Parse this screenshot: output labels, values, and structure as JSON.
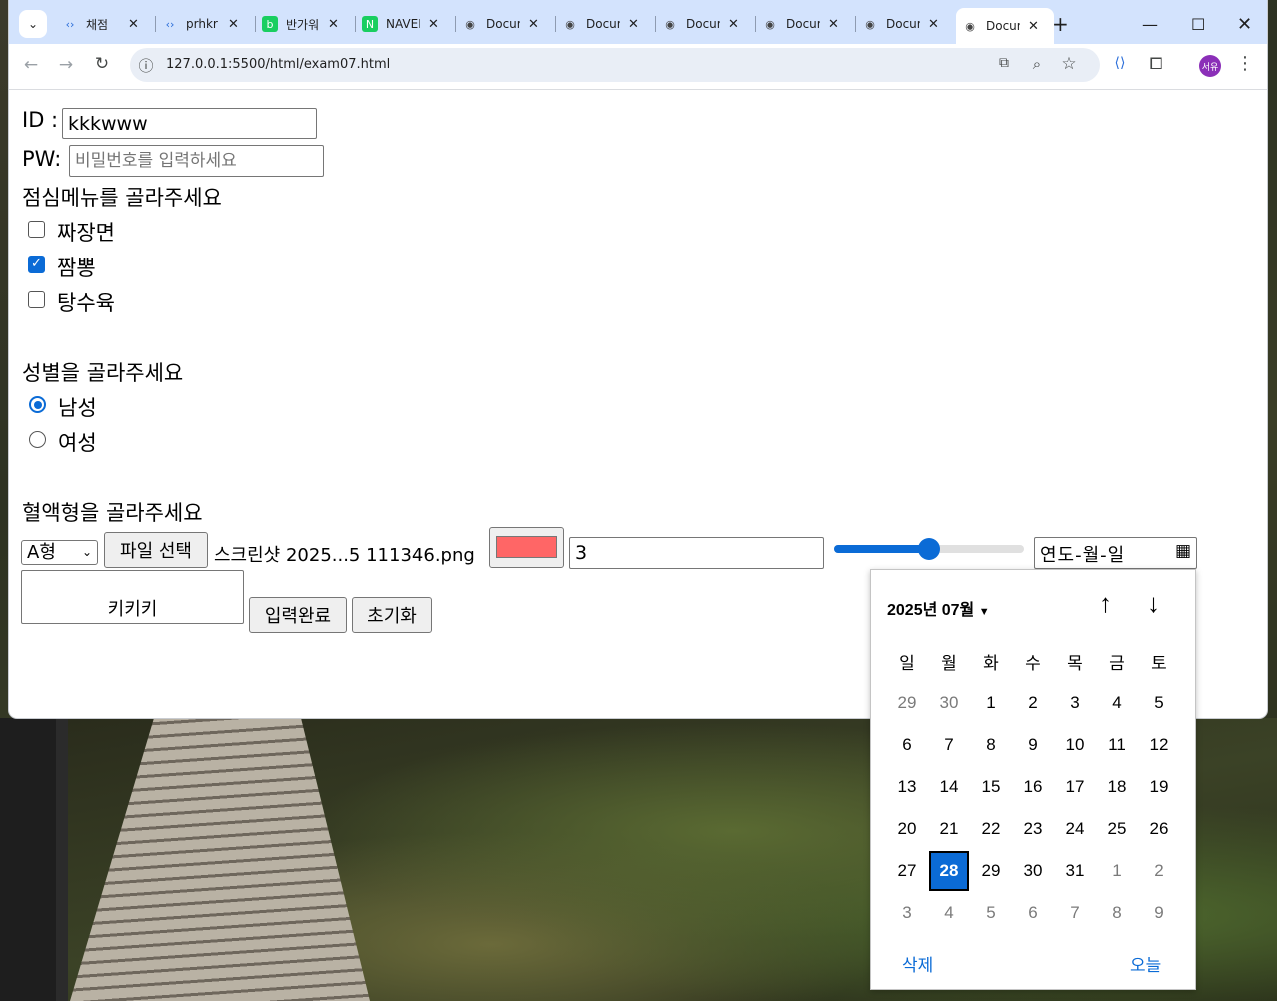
{
  "browser": {
    "tabs": [
      {
        "label": "채점",
        "icon": "code-icon"
      },
      {
        "label": "prhkr",
        "icon": "code-icon"
      },
      {
        "label": "반가워",
        "icon": "blog-icon"
      },
      {
        "label": "NAVER",
        "icon": "naver-icon"
      },
      {
        "label": "Document",
        "icon": "globe-icon"
      },
      {
        "label": "Document",
        "icon": "globe-icon"
      },
      {
        "label": "Document",
        "icon": "globe-icon"
      },
      {
        "label": "Document",
        "icon": "globe-icon"
      },
      {
        "label": "Document",
        "icon": "globe-icon"
      },
      {
        "label": "Document",
        "icon": "globe-icon"
      }
    ],
    "url": "127.0.0.1:5500/html/exam07.html",
    "profile_initials": "서유"
  },
  "form": {
    "id_label": "ID :",
    "id_value": "kkkwww",
    "pw_label": "PW:",
    "pw_placeholder": "비밀번호를 입력하세요",
    "lunch_title": "점심메뉴를 골라주세요",
    "lunch_options": [
      {
        "label": "짜장면",
        "checked": false
      },
      {
        "label": "짬뽕",
        "checked": true
      },
      {
        "label": "탕수육",
        "checked": false
      }
    ],
    "gender_title": "성별을 골라주세요",
    "gender_options": [
      {
        "label": "남성",
        "checked": true
      },
      {
        "label": "여성",
        "checked": false
      }
    ],
    "blood_title": "혈액형을 골라주세요",
    "blood_selected": "A형",
    "file_button": "파일 선택",
    "file_name": "스크린샷 2025...5 111346.png",
    "color_value": "#ff6666",
    "number_value": "3",
    "range_value": 0.5,
    "date_placeholder": "연도-월-일",
    "textarea_value": "키키키",
    "submit_label": "입력완료",
    "reset_label": "초기화"
  },
  "calendar": {
    "month_label": "2025년 07월",
    "weekdays": [
      "일",
      "월",
      "화",
      "수",
      "목",
      "금",
      "토"
    ],
    "weeks": [
      [
        "29",
        "30",
        "1",
        "2",
        "3",
        "4",
        "5"
      ],
      [
        "6",
        "7",
        "8",
        "9",
        "10",
        "11",
        "12"
      ],
      [
        "13",
        "14",
        "15",
        "16",
        "17",
        "18",
        "19"
      ],
      [
        "20",
        "21",
        "22",
        "23",
        "24",
        "25",
        "26"
      ],
      [
        "27",
        "28",
        "29",
        "30",
        "31",
        "1",
        "2"
      ],
      [
        "3",
        "4",
        "5",
        "6",
        "7",
        "8",
        "9"
      ]
    ],
    "selected_day": "28",
    "clear_label": "삭제",
    "today_label": "오늘"
  }
}
